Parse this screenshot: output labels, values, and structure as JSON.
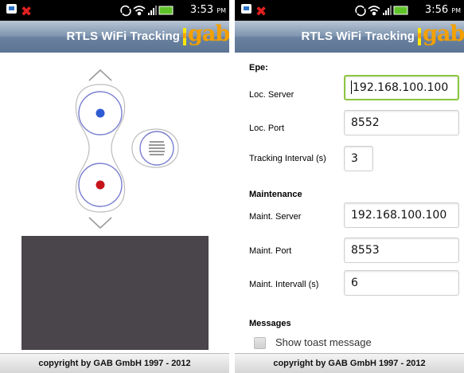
{
  "left": {
    "status": {
      "time": "3:53",
      "ampm": "PM"
    },
    "app_title": "RTLS WiFi Tracking",
    "logo_text": "gab",
    "footer": "copyright by GAB GmbH 1997 - 2012"
  },
  "right": {
    "status": {
      "time": "3:56",
      "ampm": "PM"
    },
    "app_title": "RTLS WiFi Tracking",
    "logo_text": "gab",
    "sections": {
      "epe": "Epe:",
      "maintenance": "Maintenance",
      "messages": "Messages"
    },
    "fields": {
      "loc_server": {
        "label": "Loc. Server",
        "value": "192.168.100.100"
      },
      "loc_port": {
        "label": "Loc. Port",
        "value": "8552"
      },
      "tracking_interval": {
        "label": "Tracking Interval (s)",
        "value": "3"
      },
      "maint_server": {
        "label": "Maint. Server",
        "value": "192.168.100.100"
      },
      "maint_port": {
        "label": "Maint. Port",
        "value": "8553"
      },
      "maint_interval": {
        "label": "Maint. Intervall (s)",
        "value": "6"
      }
    },
    "show_toast": {
      "label": "Show toast message",
      "checked": false
    },
    "footer": "copyright by GAB GmbH 1997 - 2012"
  },
  "colors": {
    "titlebar": "#6a82a0",
    "logo_orange": "#f3a000",
    "focus_green": "#8cc63f",
    "dot_blue": "#2f5bd4",
    "dot_red": "#c4141a",
    "map_panel": "#49454a"
  },
  "icons": [
    "notification-icon",
    "missed-call-icon",
    "sync-icon",
    "wifi-icon",
    "signal-icon",
    "battery-icon",
    "alarm-icon",
    "menu-lines-icon",
    "arrow-up-icon",
    "arrow-down-icon"
  ]
}
